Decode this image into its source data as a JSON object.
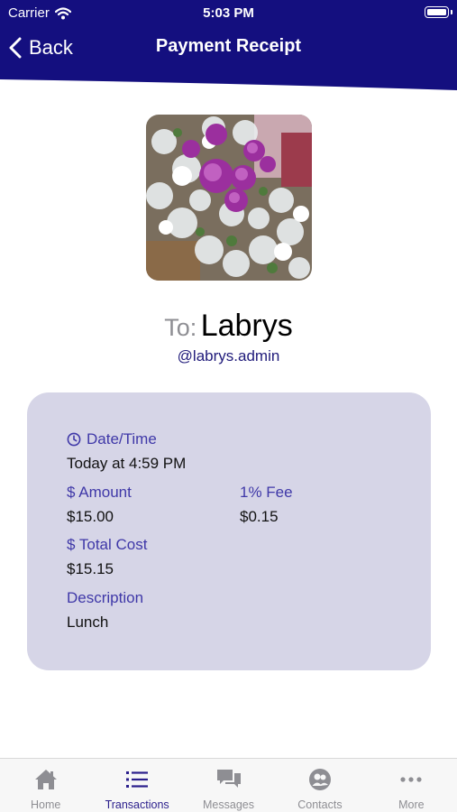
{
  "status_bar": {
    "carrier": "Carrier",
    "time": "5:03 PM"
  },
  "nav": {
    "back_label": "Back",
    "title": "Payment Receipt"
  },
  "colors": {
    "header": "#140f7f",
    "accent": "#3f38a8",
    "card": "#d6d5e7",
    "active_tab": "#2a1e8c",
    "inactive_tab": "#8e8e93"
  },
  "recipient": {
    "to_label": "To:",
    "name": "Labrys",
    "handle": "@labrys.admin"
  },
  "details": {
    "datetime_label": "Date/Time",
    "datetime_value": "Today at 4:59 PM",
    "amount_label": "$ Amount",
    "amount_value": "$15.00",
    "fee_label": "1% Fee",
    "fee_value": "$0.15",
    "total_label": "$ Total Cost",
    "total_value": "$15.15",
    "description_label": "Description",
    "description_value": "Lunch"
  },
  "tabs": [
    {
      "label": "Home",
      "icon": "home-icon",
      "active": false
    },
    {
      "label": "Transactions",
      "icon": "list-icon",
      "active": true
    },
    {
      "label": "Messages",
      "icon": "messages-icon",
      "active": false
    },
    {
      "label": "Contacts",
      "icon": "contacts-icon",
      "active": false
    },
    {
      "label": "More",
      "icon": "more-icon",
      "active": false
    }
  ]
}
